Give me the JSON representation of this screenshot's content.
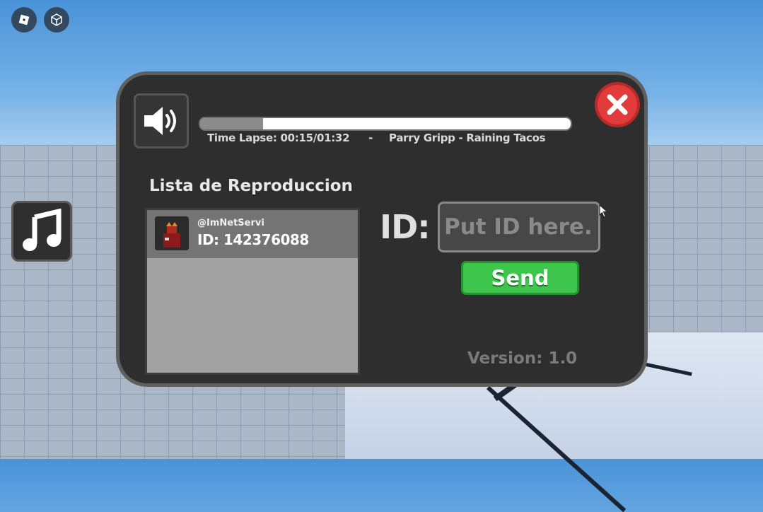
{
  "app": {
    "top_buttons": [
      {
        "icon": "roblox-logo-icon"
      },
      {
        "icon": "cube-icon"
      }
    ],
    "music_button_icon": "music-note-icon"
  },
  "player": {
    "speaker_icon": "speaker-volume-icon",
    "progress": 0.17,
    "time_text": "Time Lapse: 00:15/01:32",
    "separator": "-",
    "song_title": "Parry Gripp - Raining Tacos",
    "close_icon": "close-icon"
  },
  "playlist": {
    "title": "Lista de Reproduccion",
    "items": [
      {
        "user": "@ImNetServi",
        "id_text": "ID: 142376088"
      }
    ]
  },
  "id_entry": {
    "label": "ID:",
    "placeholder": "Put ID here...",
    "value": "",
    "send_label": "Send"
  },
  "version": "Version: 1.0",
  "colors": {
    "panel_bg": "#2e2e2e",
    "close_red": "#e23b3b",
    "send_green": "#3ec54c"
  }
}
